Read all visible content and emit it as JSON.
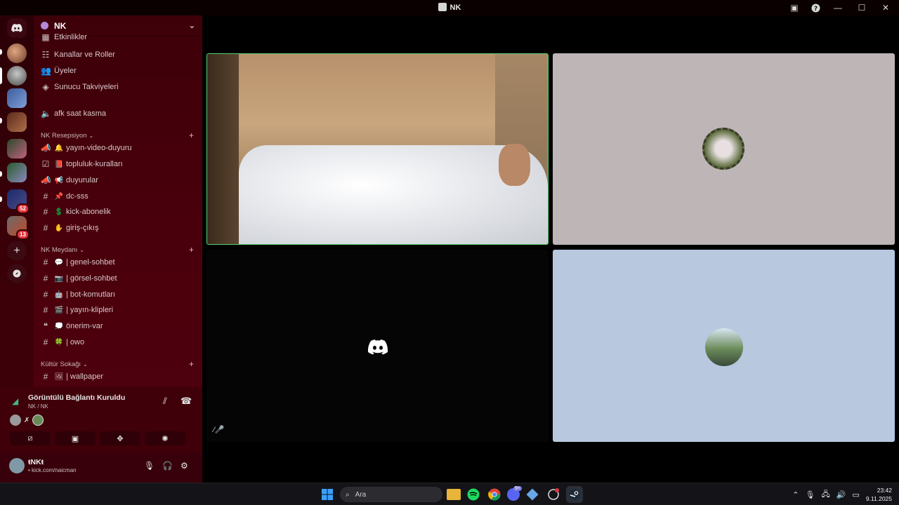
{
  "window": {
    "title": "NK"
  },
  "rail": {
    "badges": [
      "52",
      "13"
    ]
  },
  "server": {
    "name": "NK",
    "top_items": [
      {
        "label": "Etkinlikler",
        "icon": "calendar-icon"
      },
      {
        "label": "Kanallar ve Roller",
        "icon": "channels-roles-icon"
      },
      {
        "label": "Üyeler",
        "icon": "members-icon"
      },
      {
        "label": "Sunucu Takviyeleri",
        "icon": "boost-icon"
      }
    ],
    "afk_channel": "afk saat kasma",
    "categories": [
      {
        "name": "NK Resepsiyon",
        "channels": [
          {
            "label": "yayın-video-duyuru",
            "icon": "announcement-icon",
            "emoji": "🔔"
          },
          {
            "label": "topluluk-kuralları",
            "icon": "rules-icon",
            "emoji": "📕"
          },
          {
            "label": "duyurular",
            "icon": "announcement-icon",
            "emoji": "📢"
          },
          {
            "label": "dc-sss",
            "icon": "hash-icon",
            "emoji": "📌"
          },
          {
            "label": "kick-abonelik",
            "icon": "hash-icon",
            "emoji": "💲"
          },
          {
            "label": "giriş-çıkış",
            "icon": "hash-icon",
            "emoji": "✋"
          }
        ]
      },
      {
        "name": "NK Meydanı",
        "channels": [
          {
            "label": "| genel-sohbet",
            "icon": "hash-icon",
            "emoji": "💬"
          },
          {
            "label": "| görsel-sohbet",
            "icon": "hash-icon",
            "emoji": "📷"
          },
          {
            "label": "| bot-komutları",
            "icon": "hash-icon",
            "emoji": "🤖"
          },
          {
            "label": "| yayın-klipleri",
            "icon": "hash-icon",
            "emoji": "🎬"
          },
          {
            "label": "önerim-var",
            "icon": "forum-icon",
            "emoji": "💭"
          },
          {
            "label": "| owo",
            "icon": "hash-icon",
            "emoji": "🍀"
          }
        ]
      },
      {
        "name": "Kültür Sokağı",
        "channels": [
          {
            "label": "| wallpaper",
            "icon": "hash-icon",
            "emoji": "🖼"
          }
        ]
      }
    ]
  },
  "voice": {
    "status": "Görüntülü Bağlantı Kuruldu",
    "location": "NK / NK"
  },
  "user": {
    "name": "ŧNKŧ",
    "status": "• kick.com/naicman"
  },
  "taskbar": {
    "search_placeholder": "Ara",
    "time": "23:42",
    "date": "9.11.2025",
    "discord_badge": "9+"
  },
  "colors": {
    "accent_green": "#57d16a",
    "sidebar_bg": "#4a000c",
    "badge_red": "#e0343c"
  }
}
